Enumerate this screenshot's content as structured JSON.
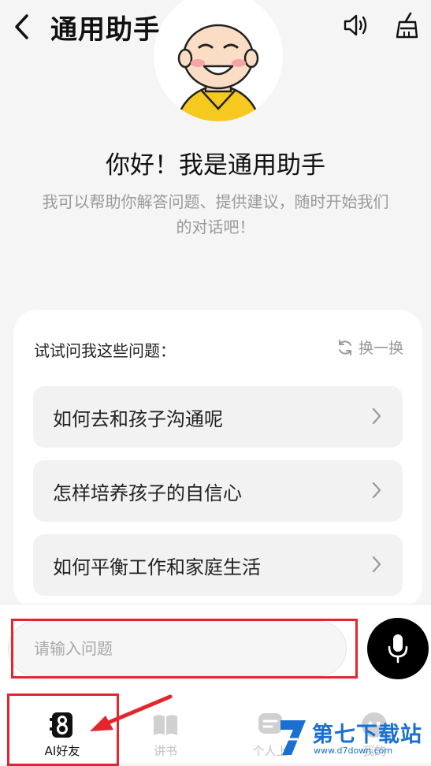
{
  "header": {
    "title": "通用助手"
  },
  "hero": {
    "greeting": "你好！我是通用助手",
    "intro": "我可以帮助你解答问题、提供建议，随时开始我们的对话吧！"
  },
  "suggestions": {
    "title": "试试问我这些问题：",
    "refresh_label": "换一换",
    "items": [
      {
        "label": "如何去和孩子沟通呢"
      },
      {
        "label": "怎样培养孩子的自信心"
      },
      {
        "label": "如何平衡工作和家庭生活"
      }
    ]
  },
  "input": {
    "placeholder": "请输入问题",
    "value": ""
  },
  "tabbar": {
    "items": [
      {
        "label": "AI好友",
        "active": true
      },
      {
        "label": "讲书",
        "active": false
      },
      {
        "label": "个人上",
        "active": false
      },
      {
        "label": "我的",
        "active": false
      }
    ]
  },
  "watermark": {
    "name": "第七下载站",
    "url": "www.d7down.com"
  },
  "colors": {
    "accent": "#000000",
    "highlight_box": "#e2262c",
    "watermark": "#1a6fd0"
  }
}
